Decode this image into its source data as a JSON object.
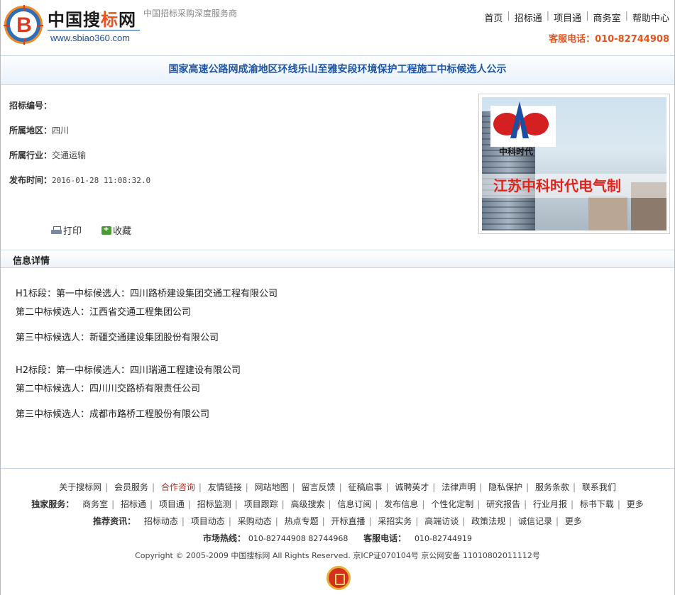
{
  "header": {
    "brand_prefix": "中国搜",
    "brand_highlight": "标",
    "brand_suffix": "网",
    "url": "www.sbiao360.com",
    "slogan": "中国招标采购深度服务商",
    "nav": [
      "首页",
      "招标通",
      "项目通",
      "商务室",
      "帮助中心"
    ],
    "hotline": "客服电话：010-82744908"
  },
  "page_title": "国家高速公路网成渝地区环线乐山至雅安段环境保护工程施工中标候选人公示",
  "meta": [
    {
      "key": "招标编号：",
      "value": ""
    },
    {
      "key": "所属地区：",
      "value": "四川"
    },
    {
      "key": "所属行业：",
      "value": "交通运输"
    },
    {
      "key": "发布时间：",
      "value": "2016-01-28 11:08:32.0"
    }
  ],
  "actions": {
    "print": "打印",
    "favorite": "收藏"
  },
  "ad": {
    "logo_text": "中科时代",
    "company": "江苏中科时代电气制"
  },
  "detail": {
    "heading": "信息详情",
    "lines": [
      "H1标段：第一中标候选人：四川路桥建设集团交通工程有限公司",
      "第二中标候选人：江西省交通工程集团公司",
      "第三中标候选人：新疆交通建设集团股份有限公司",
      "H2标段：第一中标候选人：四川瑞通工程建设有限公司",
      "第二中标候选人：四川川交路桥有限责任公司",
      "第三中标候选人：成都市路桥工程股份有限公司"
    ]
  },
  "footer": {
    "links": [
      "关于搜标网",
      "会员服务",
      "合作咨询",
      "友情链接",
      "网站地图",
      "留言反馈",
      "征稿启事",
      "诚聘英才",
      "法律声明",
      "隐私保护",
      "服务条款",
      "联系我们"
    ],
    "exclusive_label": "独家服务：",
    "exclusive": [
      "商务室",
      "招标通",
      "项目通",
      "招标监测",
      "项目跟踪",
      "高级搜索",
      "信息订阅",
      "发布信息",
      "个性化定制",
      "研究报告",
      "行业月报",
      "标书下载",
      "更多"
    ],
    "recommend_label": "推荐资讯：",
    "recommend": [
      "招标动态",
      "项目动态",
      "采购动态",
      "热点专题",
      "开标直播",
      "采招实务",
      "高端访谈",
      "政策法规",
      "诚信记录",
      "更多"
    ],
    "market_label": "市场热线：",
    "market_phone": "010-82744908  82744968",
    "service_label": "客服电话：",
    "service_phone": "010-82744919",
    "copyright": "Copyright © 2005-2009 中国搜标网 All Rights Reserved. 京ICP证070104号 京公网安备 11010802011112号"
  },
  "colors": {
    "accent": "#e8541e",
    "title_blue": "#1d55a8",
    "link_red": "#c2291b"
  }
}
